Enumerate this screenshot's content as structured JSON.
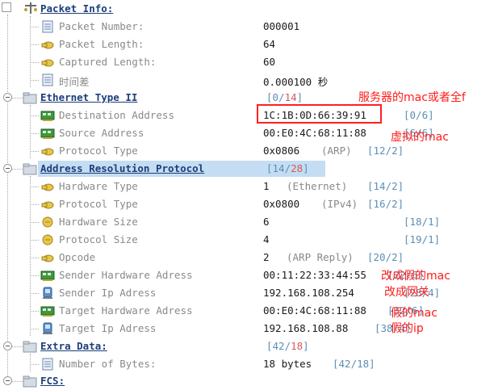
{
  "sections": {
    "packet_info": {
      "title": "Packet Info:",
      "fields": [
        {
          "name": "Packet Number:",
          "value": "000001"
        },
        {
          "name": "Packet Length:",
          "value": "64"
        },
        {
          "name": "Captured Length:",
          "value": "60"
        },
        {
          "name": "时间差",
          "value": "0.000100 秒"
        }
      ]
    },
    "ethernet": {
      "title": "Ethernet Type II",
      "offset": "[0/",
      "offset_red": "14",
      "offset_end": "]",
      "fields": [
        {
          "name": "Destination Address",
          "value": "1C:1B:0D:66:39:91",
          "offset": "[0/6]"
        },
        {
          "name": "Source Address",
          "value": "00:E0:4C:68:11:88",
          "offset": "[6/6]"
        },
        {
          "name": "Protocol Type",
          "value": "0x0806",
          "sub": "(ARP)",
          "offset": "[12/2]"
        }
      ]
    },
    "arp": {
      "title": "Address Resolution Protocol",
      "offset": "[14/",
      "offset_red": "28",
      "offset_end": "]",
      "fields": [
        {
          "name": "Hardware Type",
          "value": "1",
          "sub": "(Ethernet)",
          "offset": "[14/2]"
        },
        {
          "name": "Protocol Type",
          "value": "0x0800",
          "sub": "(IPv4)",
          "offset": "[16/2]"
        },
        {
          "name": "Hardware Size",
          "value": "6",
          "offset": "[18/1]"
        },
        {
          "name": "Protocol Size",
          "value": "4",
          "offset": "[19/1]"
        },
        {
          "name": "Opcode",
          "value": "2",
          "sub": "(ARP Reply)",
          "offset": "[20/2]"
        },
        {
          "name": "Sender Hardware Adress",
          "value": "00:11:22:33:44:55",
          "offset": "[22/6]"
        },
        {
          "name": "Sender Ip Adress",
          "value": "192.168.108.254",
          "offset": "[28/4]"
        },
        {
          "name": "Target Hardware Adress",
          "value": "00:E0:4C:68:11:88",
          "offset": "[32/6]"
        },
        {
          "name": "Target Ip Adress",
          "value": "192.168.108.88",
          "offset": "[38/4]"
        }
      ]
    },
    "extra": {
      "title": "Extra Data:",
      "offset": "[42/",
      "offset_red": "18",
      "offset_end": "]",
      "fields": [
        {
          "name": "Number of Bytes:",
          "value": "18 bytes",
          "offset": "[42/18]"
        }
      ]
    },
    "fcs": {
      "title": "FCS:"
    }
  },
  "annotations": [
    "服务器的mac或者全f",
    "虚拟的mac",
    "改成假的mac",
    "改成网关",
    "假的mac",
    "假的ip"
  ],
  "colors": {
    "annotation": "#ff1a1a",
    "section_title": "#1d3f7a",
    "selection": "#c5ddf2",
    "offset": "#5c8fb4",
    "field_name": "#8a8a8a"
  }
}
